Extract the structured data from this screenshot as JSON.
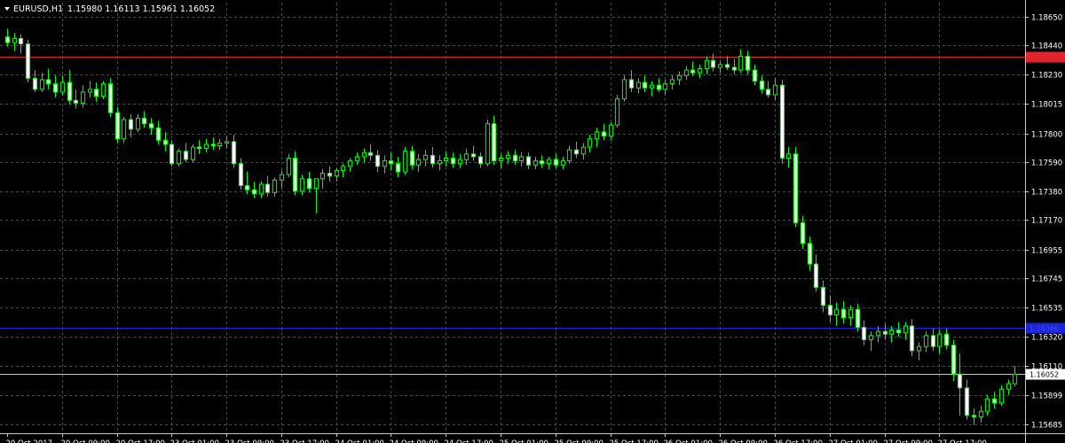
{
  "chart_data": {
    "type": "candlestick",
    "title": "EURUSD,H1",
    "ohlc_header": "1.15980 1.16113 1.15961 1.16052",
    "ylim": [
      1.1562,
      1.1875
    ],
    "y_ticks": [
      "1.18650",
      "1.18440",
      "1.18230",
      "1.18015",
      "1.17800",
      "1.17590",
      "1.17380",
      "1.17170",
      "1.16955",
      "1.16745",
      "1.16535",
      "1.16320",
      "1.16110",
      "1.15899",
      "1.15685"
    ],
    "x_ticks": [
      "20 Oct 2017",
      "20 Oct 09:00",
      "20 Oct 17:00",
      "23 Oct 01:00",
      "23 Oct 09:00",
      "23 Oct 17:00",
      "24 Oct 01:00",
      "24 Oct 09:00",
      "24 Oct 17:00",
      "25 Oct 01:00",
      "25 Oct 09:00",
      "25 Oct 17:00",
      "26 Oct 01:00",
      "26 Oct 09:00",
      "26 Oct 17:00",
      "27 Oct 01:00",
      "27 Oct 09:00",
      "27 Oct 17:00"
    ],
    "grid": true,
    "levels": [
      {
        "label": "1.18356",
        "value": 1.18356,
        "color": "#e0242b",
        "tag_text": "#e0242b"
      },
      {
        "label": "1.16386",
        "value": 1.16386,
        "color": "#1b24d6",
        "tag_text": "#3a48ff"
      },
      {
        "label": "1.16052",
        "value": 1.16052,
        "color": "#c8c8c8",
        "tag_text": "#000000"
      }
    ],
    "candles": [
      [
        1.185,
        1.1856,
        1.1843,
        1.1846
      ],
      [
        1.1846,
        1.1853,
        1.184,
        1.1849
      ],
      [
        1.1849,
        1.1852,
        1.1838,
        1.1845
      ],
      [
        1.1845,
        1.1848,
        1.1817,
        1.182
      ],
      [
        1.182,
        1.1826,
        1.181,
        1.1812
      ],
      [
        1.1812,
        1.1824,
        1.181,
        1.1819
      ],
      [
        1.1819,
        1.1827,
        1.1812,
        1.1816
      ],
      [
        1.1816,
        1.1822,
        1.1806,
        1.181
      ],
      [
        1.181,
        1.1822,
        1.1808,
        1.1817
      ],
      [
        1.1817,
        1.1826,
        1.1801,
        1.1804
      ],
      [
        1.1804,
        1.1812,
        1.1798,
        1.1802
      ],
      [
        1.1802,
        1.1815,
        1.1799,
        1.181
      ],
      [
        1.181,
        1.1818,
        1.1806,
        1.1812
      ],
      [
        1.1812,
        1.1817,
        1.1803,
        1.1807
      ],
      [
        1.1807,
        1.1818,
        1.1805,
        1.1816
      ],
      [
        1.1816,
        1.182,
        1.1792,
        1.1795
      ],
      [
        1.1795,
        1.1799,
        1.1773,
        1.1776
      ],
      [
        1.1776,
        1.1792,
        1.1773,
        1.179
      ],
      [
        1.179,
        1.1794,
        1.1777,
        1.1783
      ],
      [
        1.1783,
        1.1794,
        1.1781,
        1.1791
      ],
      [
        1.1791,
        1.1796,
        1.1784,
        1.1787
      ],
      [
        1.1787,
        1.1791,
        1.1779,
        1.1784
      ],
      [
        1.1784,
        1.1789,
        1.1772,
        1.1775
      ],
      [
        1.1775,
        1.1781,
        1.1767,
        1.1772
      ],
      [
        1.1772,
        1.1775,
        1.1756,
        1.1758
      ],
      [
        1.1758,
        1.1769,
        1.1756,
        1.1767
      ],
      [
        1.1767,
        1.1773,
        1.1759,
        1.1761
      ],
      [
        1.1761,
        1.1772,
        1.1759,
        1.177
      ],
      [
        1.177,
        1.1775,
        1.1765,
        1.1769
      ],
      [
        1.1769,
        1.1776,
        1.1766,
        1.1772
      ],
      [
        1.1772,
        1.1777,
        1.1768,
        1.1771
      ],
      [
        1.1771,
        1.1776,
        1.1768,
        1.1773
      ],
      [
        1.1773,
        1.1778,
        1.1769,
        1.1774
      ],
      [
        1.1774,
        1.1779,
        1.1755,
        1.1758
      ],
      [
        1.1758,
        1.1762,
        1.1739,
        1.1742
      ],
      [
        1.1742,
        1.1752,
        1.1736,
        1.1739
      ],
      [
        1.1739,
        1.1745,
        1.1733,
        1.1736
      ],
      [
        1.1736,
        1.1745,
        1.1733,
        1.1743
      ],
      [
        1.1743,
        1.1749,
        1.1734,
        1.1737
      ],
      [
        1.1737,
        1.1748,
        1.1734,
        1.1746
      ],
      [
        1.1746,
        1.1753,
        1.174,
        1.175
      ],
      [
        1.175,
        1.1765,
        1.1748,
        1.1762
      ],
      [
        1.1762,
        1.1767,
        1.1735,
        1.1738
      ],
      [
        1.1738,
        1.175,
        1.1735,
        1.1747
      ],
      [
        1.1747,
        1.1752,
        1.1737,
        1.174
      ],
      [
        1.174,
        1.1745,
        1.1722,
        1.1747
      ],
      [
        1.1747,
        1.1754,
        1.174,
        1.1751
      ],
      [
        1.1751,
        1.1756,
        1.1745,
        1.1749
      ],
      [
        1.1749,
        1.1755,
        1.1745,
        1.1753
      ],
      [
        1.1753,
        1.1758,
        1.1748,
        1.1756
      ],
      [
        1.1756,
        1.1762,
        1.1752,
        1.176
      ],
      [
        1.176,
        1.1766,
        1.1757,
        1.1763
      ],
      [
        1.1763,
        1.1769,
        1.1759,
        1.1766
      ],
      [
        1.1766,
        1.1772,
        1.176,
        1.1764
      ],
      [
        1.1764,
        1.1768,
        1.1752,
        1.1756
      ],
      [
        1.1756,
        1.1764,
        1.1751,
        1.176
      ],
      [
        1.176,
        1.1766,
        1.1753,
        1.1758
      ],
      [
        1.1758,
        1.1763,
        1.1748,
        1.1752
      ],
      [
        1.1752,
        1.177,
        1.175,
        1.1767
      ],
      [
        1.1767,
        1.1771,
        1.1754,
        1.1757
      ],
      [
        1.1757,
        1.1765,
        1.1752,
        1.1761
      ],
      [
        1.1761,
        1.1768,
        1.1756,
        1.1764
      ],
      [
        1.1764,
        1.177,
        1.1755,
        1.1758
      ],
      [
        1.1758,
        1.1764,
        1.1753,
        1.176
      ],
      [
        1.176,
        1.1767,
        1.1756,
        1.1762
      ],
      [
        1.1762,
        1.1766,
        1.1755,
        1.1758
      ],
      [
        1.1758,
        1.1765,
        1.1755,
        1.1761
      ],
      [
        1.1761,
        1.1769,
        1.1757,
        1.1765
      ],
      [
        1.1765,
        1.1771,
        1.176,
        1.1763
      ],
      [
        1.1763,
        1.1766,
        1.1755,
        1.1758
      ],
      [
        1.1758,
        1.179,
        1.1756,
        1.1787
      ],
      [
        1.1787,
        1.1793,
        1.1757,
        1.176
      ],
      [
        1.176,
        1.1765,
        1.1755,
        1.1762
      ],
      [
        1.1762,
        1.1767,
        1.1758,
        1.1764
      ],
      [
        1.1764,
        1.1768,
        1.1757,
        1.176
      ],
      [
        1.176,
        1.1766,
        1.1756,
        1.1763
      ],
      [
        1.1763,
        1.1766,
        1.1754,
        1.1757
      ],
      [
        1.1757,
        1.1763,
        1.1754,
        1.176
      ],
      [
        1.176,
        1.1764,
        1.1755,
        1.1758
      ],
      [
        1.1758,
        1.1763,
        1.1754,
        1.1761
      ],
      [
        1.1761,
        1.1765,
        1.1755,
        1.1757
      ],
      [
        1.1757,
        1.1763,
        1.1754,
        1.176
      ],
      [
        1.176,
        1.1771,
        1.1758,
        1.1768
      ],
      [
        1.1768,
        1.1774,
        1.1762,
        1.1765
      ],
      [
        1.1765,
        1.1773,
        1.1761,
        1.177
      ],
      [
        1.177,
        1.1779,
        1.1766,
        1.1776
      ],
      [
        1.1776,
        1.1784,
        1.177,
        1.1781
      ],
      [
        1.1781,
        1.1787,
        1.1775,
        1.1778
      ],
      [
        1.1778,
        1.1788,
        1.1775,
        1.1786
      ],
      [
        1.1786,
        1.1808,
        1.1784,
        1.1805
      ],
      [
        1.1805,
        1.1822,
        1.1803,
        1.1819
      ],
      [
        1.1819,
        1.1826,
        1.181,
        1.1813
      ],
      [
        1.1813,
        1.182,
        1.1809,
        1.1817
      ],
      [
        1.1817,
        1.1822,
        1.181,
        1.1813
      ],
      [
        1.1813,
        1.1818,
        1.1807,
        1.1815
      ],
      [
        1.1815,
        1.182,
        1.181,
        1.1812
      ],
      [
        1.1812,
        1.1819,
        1.1808,
        1.1816
      ],
      [
        1.1816,
        1.1822,
        1.1812,
        1.1819
      ],
      [
        1.1819,
        1.1825,
        1.1815,
        1.1822
      ],
      [
        1.1822,
        1.1829,
        1.1819,
        1.1826
      ],
      [
        1.1826,
        1.1832,
        1.1822,
        1.1824
      ],
      [
        1.1824,
        1.183,
        1.182,
        1.1827
      ],
      [
        1.1827,
        1.1836,
        1.1823,
        1.1833
      ],
      [
        1.1833,
        1.1838,
        1.1825,
        1.1828
      ],
      [
        1.1828,
        1.1833,
        1.1824,
        1.183
      ],
      [
        1.183,
        1.1836,
        1.1826,
        1.1828
      ],
      [
        1.1828,
        1.1834,
        1.1823,
        1.1826
      ],
      [
        1.1826,
        1.1841,
        1.1824,
        1.1836
      ],
      [
        1.1836,
        1.184,
        1.1823,
        1.1826
      ],
      [
        1.1826,
        1.183,
        1.1815,
        1.1818
      ],
      [
        1.1818,
        1.1822,
        1.1809,
        1.1812
      ],
      [
        1.1812,
        1.1818,
        1.1806,
        1.1808
      ],
      [
        1.1808,
        1.182,
        1.1804,
        1.1815
      ],
      [
        1.1815,
        1.1819,
        1.1758,
        1.1762
      ],
      [
        1.1762,
        1.177,
        1.1755,
        1.1765
      ],
      [
        1.1765,
        1.177,
        1.1712,
        1.1715
      ],
      [
        1.1715,
        1.172,
        1.1696,
        1.17
      ],
      [
        1.17,
        1.1705,
        1.168,
        1.1685
      ],
      [
        1.1685,
        1.1692,
        1.1665,
        1.1668
      ],
      [
        1.1668,
        1.1673,
        1.165,
        1.1655
      ],
      [
        1.1655,
        1.1662,
        1.1643,
        1.1648
      ],
      [
        1.1648,
        1.1657,
        1.164,
        1.1652
      ],
      [
        1.1652,
        1.1658,
        1.1642,
        1.1646
      ],
      [
        1.1646,
        1.1655,
        1.164,
        1.1652
      ],
      [
        1.1652,
        1.1656,
        1.1636,
        1.1639
      ],
      [
        1.1639,
        1.1644,
        1.1626,
        1.163
      ],
      [
        1.163,
        1.1636,
        1.1622,
        1.1633
      ],
      [
        1.1633,
        1.164,
        1.1628,
        1.1636
      ],
      [
        1.1636,
        1.1642,
        1.163,
        1.1634
      ],
      [
        1.1634,
        1.164,
        1.1628,
        1.1637
      ],
      [
        1.1637,
        1.1643,
        1.1632,
        1.1635
      ],
      [
        1.1635,
        1.1643,
        1.163,
        1.164
      ],
      [
        1.164,
        1.1645,
        1.1618,
        1.1622
      ],
      [
        1.1622,
        1.1628,
        1.1615,
        1.1625
      ],
      [
        1.1625,
        1.1636,
        1.1621,
        1.1633
      ],
      [
        1.1633,
        1.1638,
        1.1622,
        1.1625
      ],
      [
        1.1625,
        1.1637,
        1.162,
        1.1634
      ],
      [
        1.1634,
        1.1638,
        1.1623,
        1.1626
      ],
      [
        1.1626,
        1.163,
        1.16,
        1.1605
      ],
      [
        1.1605,
        1.162,
        1.1575,
        1.1595
      ],
      [
        1.1595,
        1.1601,
        1.1572,
        1.1575
      ],
      [
        1.1575,
        1.158,
        1.1568,
        1.1574
      ],
      [
        1.1574,
        1.1582,
        1.157,
        1.1578
      ],
      [
        1.1578,
        1.159,
        1.1575,
        1.1587
      ],
      [
        1.1587,
        1.1592,
        1.158,
        1.1584
      ],
      [
        1.1584,
        1.1597,
        1.1582,
        1.1594
      ],
      [
        1.1594,
        1.1601,
        1.159,
        1.1598
      ],
      [
        1.1598,
        1.1611,
        1.1596,
        1.1605
      ]
    ]
  }
}
